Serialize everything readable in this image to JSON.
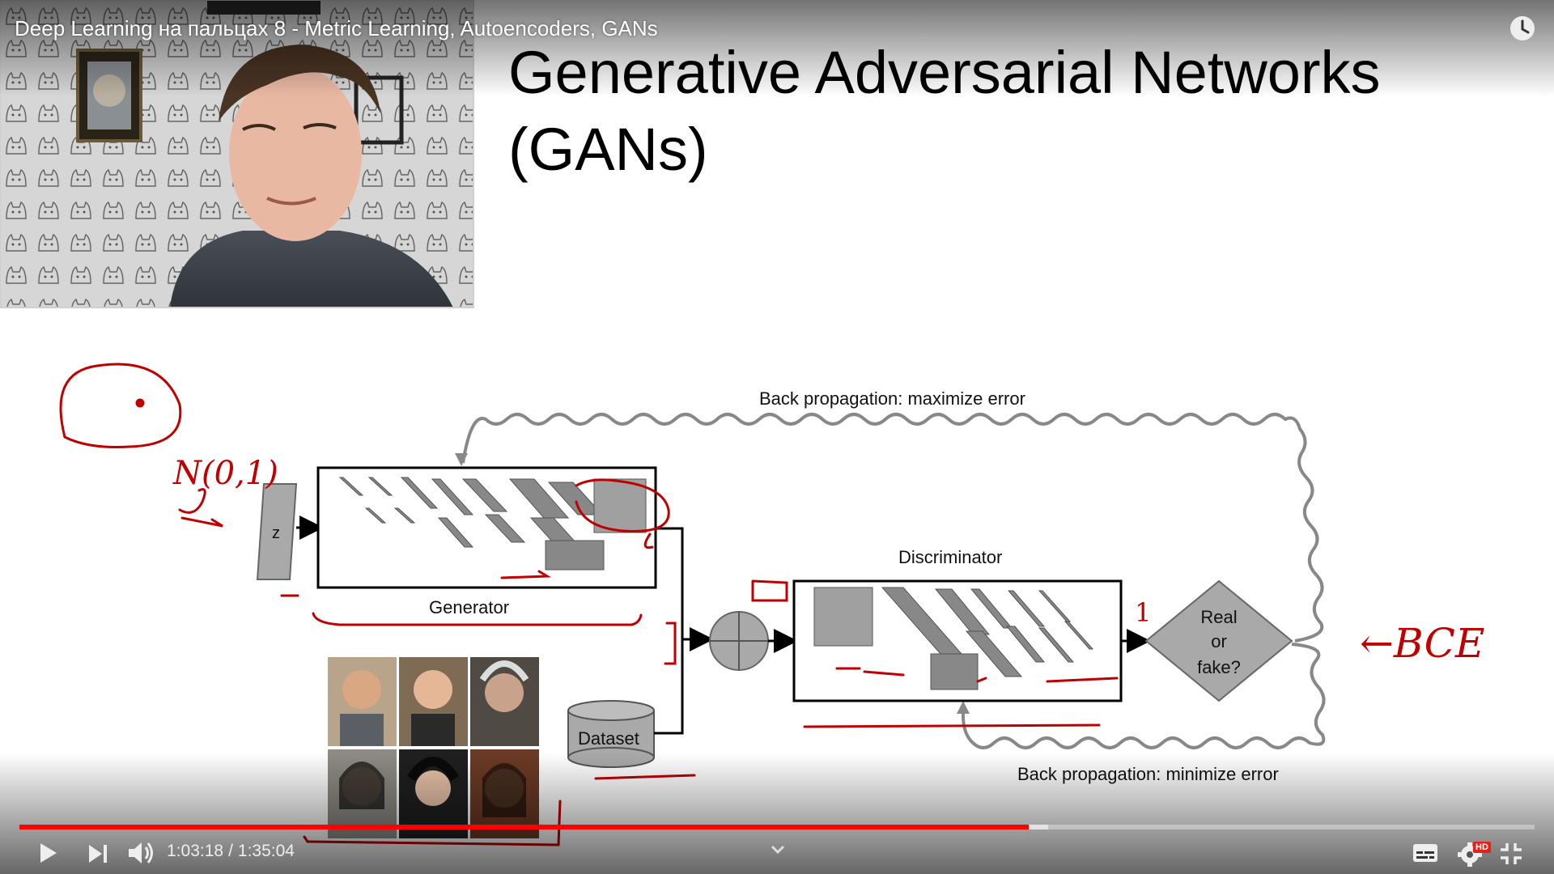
{
  "player": {
    "title": "Deep Learning на пальцах 8 - Metric Learning, Autoencoders, GANs",
    "current_time": "1:03:18",
    "time_separator": "/",
    "duration": "1:35:04",
    "progress_played": 0.666,
    "progress_buffered": 0.679,
    "colors": {
      "progress": "#ff0000",
      "hd_badge": "#e62117",
      "annotation": "#c00000"
    },
    "controls": {
      "play_icon": "play-icon",
      "next_icon": "next-icon",
      "volume_icon": "volume-icon",
      "chevron_icon": "chevron-down-icon",
      "subtitles_icon": "subtitles-icon",
      "settings_icon": "gear-icon",
      "hd_badge": "HD",
      "exit_fullscreen_icon": "exit-fullscreen-icon",
      "watch_later_icon": "clock-icon"
    }
  },
  "slide": {
    "title_line1": "Generative Adversarial Networks",
    "title_line2": "(GANs)",
    "diagram": {
      "top_label": "Back propagation: maximize error",
      "bottom_label": "Back propagation: minimize error",
      "z_label": "z",
      "generator_label": "Generator",
      "discriminator_label": "Discriminator",
      "dataset_label": "Dataset",
      "decision_line1": "Real",
      "decision_line2": "or",
      "decision_line3": "fake?"
    },
    "annotations": {
      "normal_dist": "N(0,1)",
      "label_one": "1",
      "bce": "←BCE"
    }
  }
}
